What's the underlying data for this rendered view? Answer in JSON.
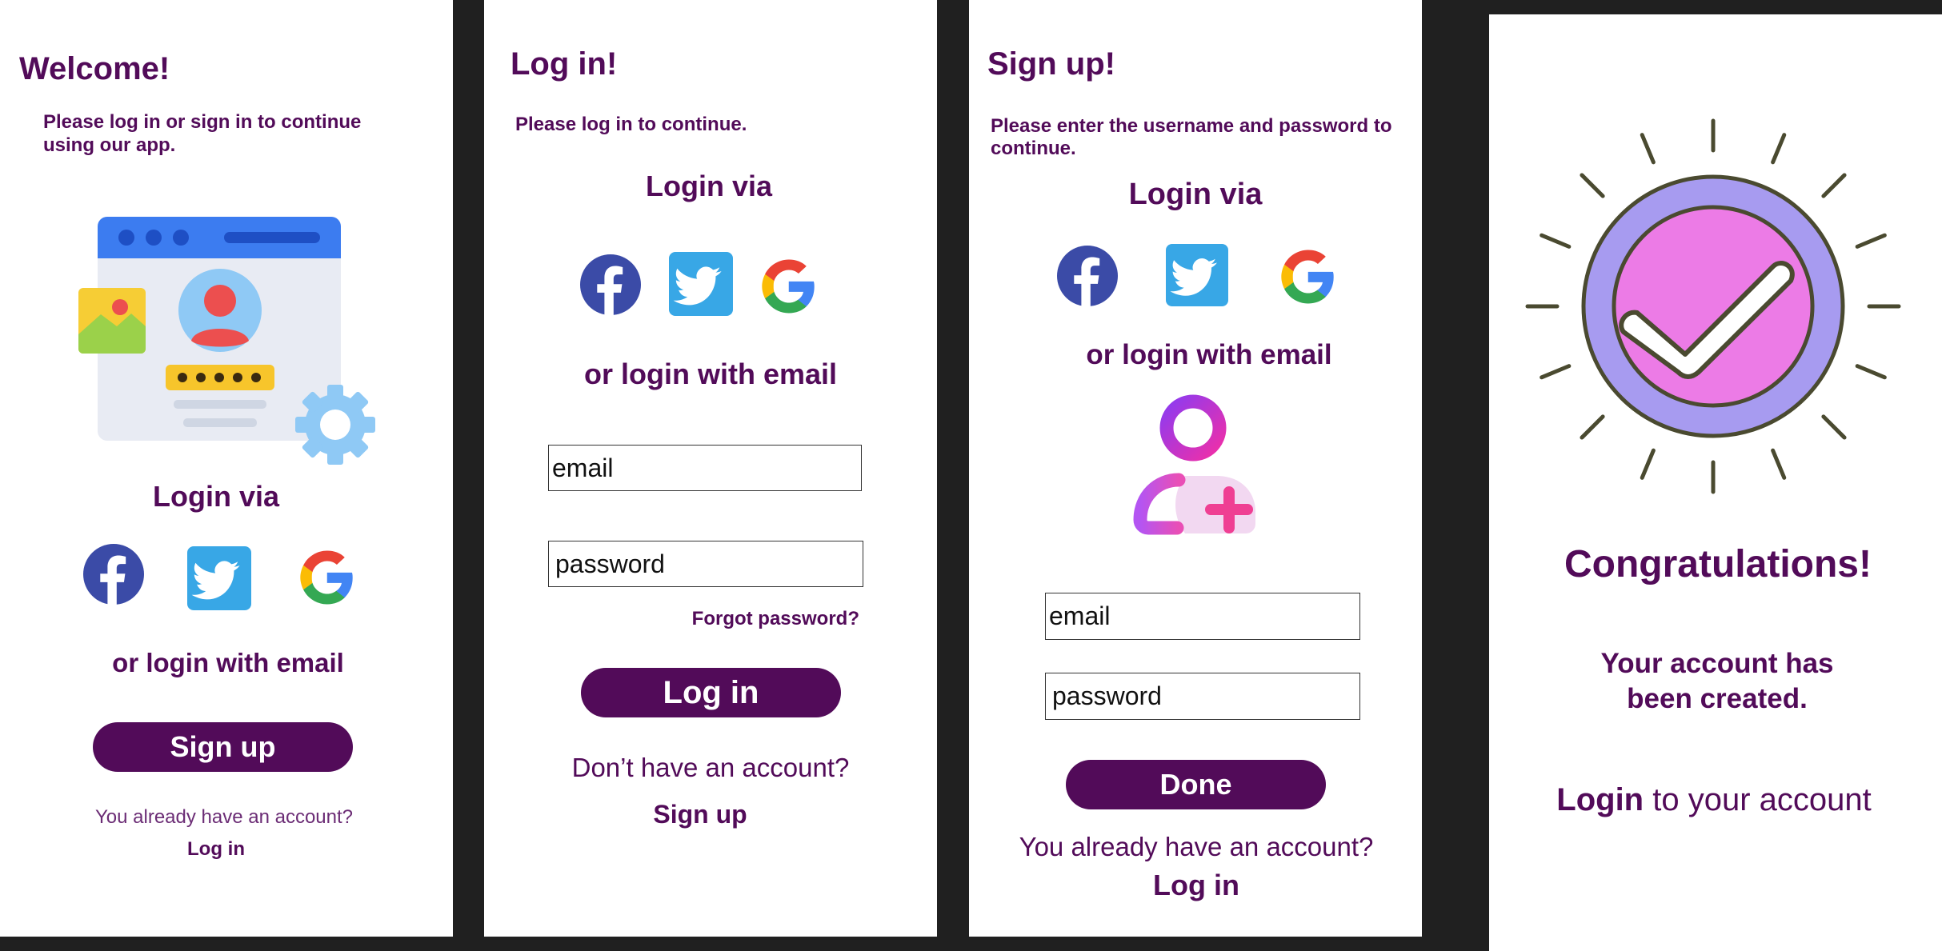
{
  "colors": {
    "brand": "#520b59",
    "facebook": "#3b4ba7",
    "twitter": "#38a7e6",
    "background": "#202020"
  },
  "welcome": {
    "title": "Welcome!",
    "subtitle": "Please log in or sign in to continue using our app.",
    "login_via": "Login via",
    "or_email": "or login with email",
    "signup_button": "Sign up",
    "have_account": "You already have an account?",
    "login_link": "Log in"
  },
  "login": {
    "title": "Log in!",
    "subtitle": "Please log in to continue.",
    "login_via": "Login via",
    "or_email": "or login with email",
    "email_placeholder": "email",
    "password_placeholder": "password",
    "forgot": "Forgot password?",
    "login_button": "Log in",
    "no_account": "Don’t have an account?",
    "signup_link": "Sign up"
  },
  "signup": {
    "title": "Sign up!",
    "subtitle": "Please enter the username and password to continue.",
    "login_via": "Login via",
    "or_email": "or login with email",
    "email_placeholder": "email",
    "password_placeholder": "password",
    "done_button": "Done",
    "have_account": "You already have an account?",
    "login_link": "Log in"
  },
  "success": {
    "title": "Congratulations!",
    "message": "Your account has been created.",
    "login_link": "Login",
    "login_suffix": " to your account"
  },
  "icons": [
    "facebook-icon",
    "twitter-icon",
    "google-icon",
    "profile-illustration",
    "add-user-icon",
    "check-badge-icon"
  ]
}
